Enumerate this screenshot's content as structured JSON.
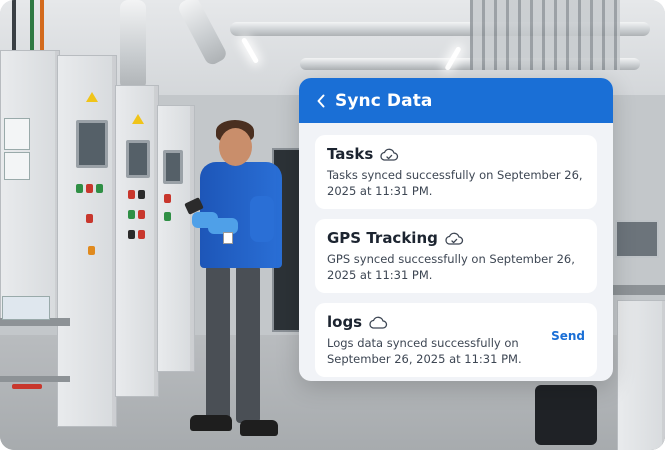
{
  "header": {
    "title": "Sync Data"
  },
  "items": [
    {
      "title": "Tasks",
      "description": "Tasks synced successfully on September 26, 2025 at 11:31 PM."
    },
    {
      "title": "GPS Tracking",
      "description": "GPS synced successfully on September 26, 2025 at 11:31 PM."
    },
    {
      "title": "logs",
      "description": "Logs data synced successfully on September 26, 2025 at 11:31 PM.",
      "action_label": "Send"
    }
  ],
  "icons": {
    "back": "chevron-left-icon",
    "cloud": "cloud-sync-icon"
  },
  "colors": {
    "accent": "#1a6fd6",
    "card_background": "#f1f3f7",
    "item_background": "#ffffff"
  }
}
